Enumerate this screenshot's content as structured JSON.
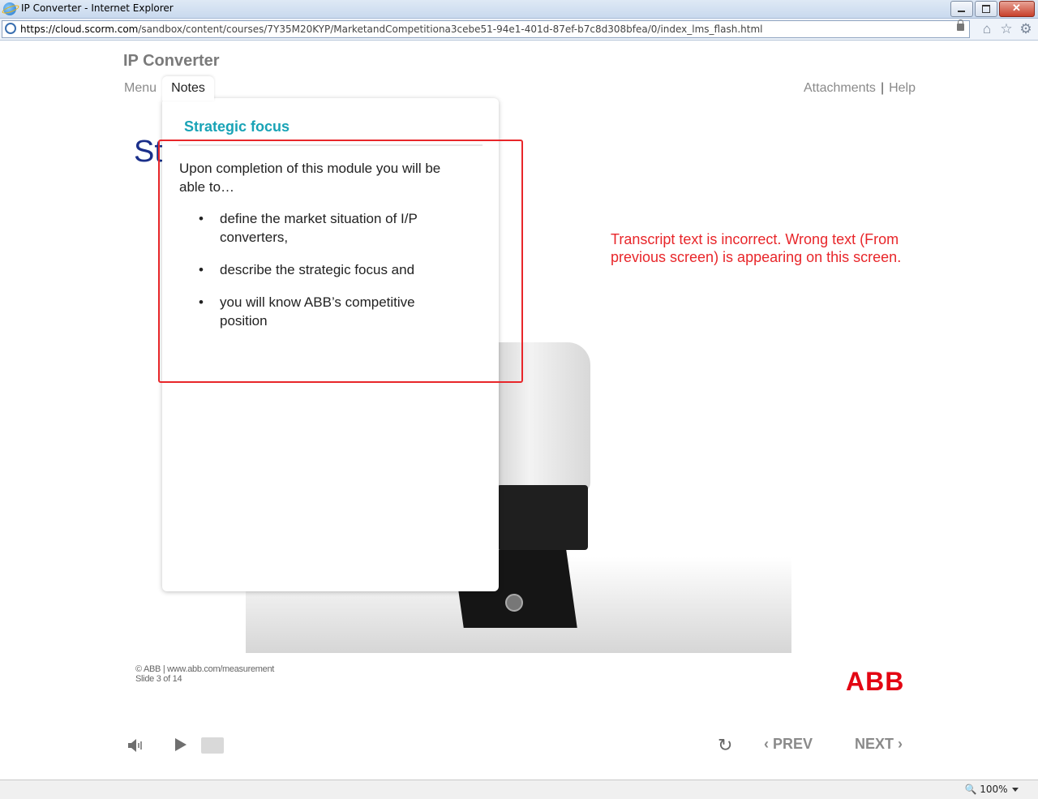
{
  "window": {
    "title": "IP Converter - Internet Explorer"
  },
  "address": {
    "domain": "https://cloud.scorm.com",
    "path": "/sandbox/content/courses/7Y35M20KYP/MarketandCompetitiona3cebe51-94e1-401d-87ef-b7c8d308bfea/0/index_lms_flash.html"
  },
  "toolbar_icons": [
    "home-icon",
    "star-icon",
    "gear-icon"
  ],
  "course": {
    "title": "IP Converter"
  },
  "nav": {
    "menu": "Menu",
    "notes": "Notes",
    "attachments": "Attachments",
    "separator": "|",
    "help": "Help"
  },
  "slide": {
    "title_fragment": "St"
  },
  "notes": {
    "heading": "Strategic focus",
    "intro": "Upon completion of this module you will be able to…",
    "items": [
      "define the market situation of I/P converters,",
      "describe the strategic focus and",
      "you will know ABB’s competitive position"
    ]
  },
  "annotation": {
    "text": "Transcript text is incorrect. Wrong text (From previous screen) is appearing on this screen.",
    "color": "#e8262a"
  },
  "footer": {
    "copyright": "© ABB | www.abb.com/measurement",
    "slide_counter": "Slide 3 of 14",
    "logo": "ABB"
  },
  "controls": {
    "prev": "PREV",
    "next": "NEXT",
    "icons": [
      "speaker-icon",
      "play-icon",
      "replay-icon"
    ]
  },
  "status": {
    "zoom": "100%"
  },
  "colors": {
    "accent": "#19a3b6",
    "title_blue": "#1a2f8a",
    "abb_red": "#e30613"
  }
}
